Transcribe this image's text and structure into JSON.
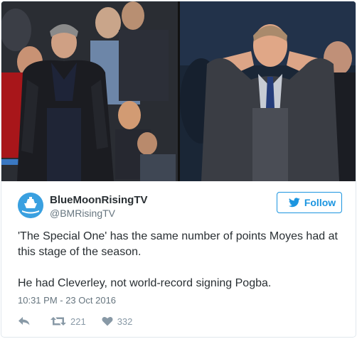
{
  "media": {
    "left_photo": "photo of a man in a dark puffer jacket standing in front of a stadium crowd",
    "right_photo": "photo of a man in a grey suit cupping his hands to his ears"
  },
  "account": {
    "name": "BlueMoonRisingTV",
    "handle": "@BMRisingTV",
    "avatar_icon": "moon-ship-avatar-icon"
  },
  "follow_button": {
    "label": "Follow",
    "icon": "twitter-bird-icon",
    "color": "#1b95e0"
  },
  "tweet": {
    "paragraphs": [
      "'The Special One' has the same number of points Moyes had at this stage of the season.",
      "He had Cleverley, not world-record signing Pogba."
    ],
    "timestamp": "10:31 PM - 23 Oct 2016"
  },
  "actions": {
    "reply_icon": "reply-icon",
    "retweet_icon": "retweet-icon",
    "retweet_count": "221",
    "like_icon": "heart-icon",
    "like_count": "332"
  }
}
